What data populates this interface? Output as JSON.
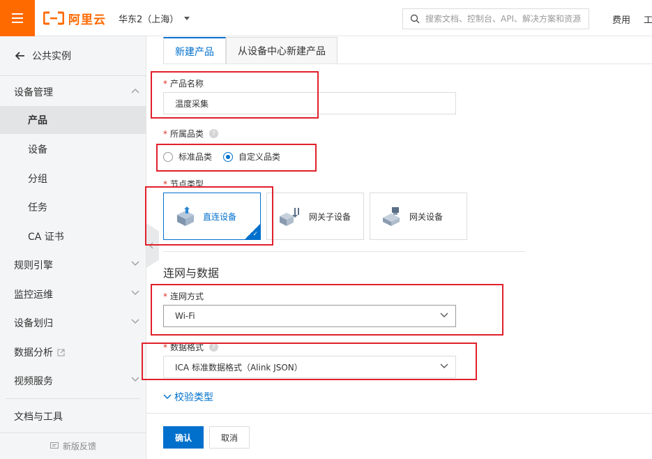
{
  "header": {
    "logo_text": "阿里云",
    "region": "华东2（上海）",
    "search_placeholder": "搜索文档、控制台、API、解决方案和资源",
    "links": [
      "费用",
      "工"
    ]
  },
  "sidebar": {
    "back_label": "公共实例",
    "groups": [
      {
        "label": "设备管理",
        "expanded": true,
        "items": [
          "产品",
          "设备",
          "分组",
          "任务",
          "CA 证书"
        ],
        "active_item": "产品"
      },
      {
        "label": "规则引擎",
        "expanded": false
      },
      {
        "label": "监控运维",
        "expanded": false
      },
      {
        "label": "设备划归",
        "expanded": false
      },
      {
        "label": "数据分析",
        "external": true
      },
      {
        "label": "视频服务",
        "expanded": false
      }
    ],
    "docs_label": "文档与工具",
    "feedback_label": "新版反馈"
  },
  "tabs": [
    {
      "label": "新建产品",
      "active": true
    },
    {
      "label": "从设备中心新建产品",
      "active": false
    }
  ],
  "form": {
    "product_name": {
      "label": "产品名称",
      "value": "温度采集"
    },
    "category": {
      "label": "所属品类",
      "options": [
        {
          "label": "标准品类",
          "selected": false
        },
        {
          "label": "自定义品类",
          "selected": true
        }
      ]
    },
    "node_type": {
      "label": "节点类型",
      "options": [
        {
          "label": "直连设备",
          "selected": true,
          "icon": "direct-device-icon"
        },
        {
          "label": "网关子设备",
          "selected": false,
          "icon": "gateway-subdevice-icon"
        },
        {
          "label": "网关设备",
          "selected": false,
          "icon": "gateway-device-icon"
        }
      ]
    },
    "section_title": "连网与数据",
    "network": {
      "label": "连网方式",
      "value": "Wi-Fi"
    },
    "data_format": {
      "label": "数据格式",
      "value": "ICA 标准数据格式（Alink JSON）"
    },
    "advanced_toggle": "校验类型"
  },
  "buttons": {
    "confirm": "确认",
    "cancel": "取消"
  },
  "colors": {
    "brand": "#ff6a00",
    "primary": "#0070cc",
    "annotation": "#e0202b"
  }
}
